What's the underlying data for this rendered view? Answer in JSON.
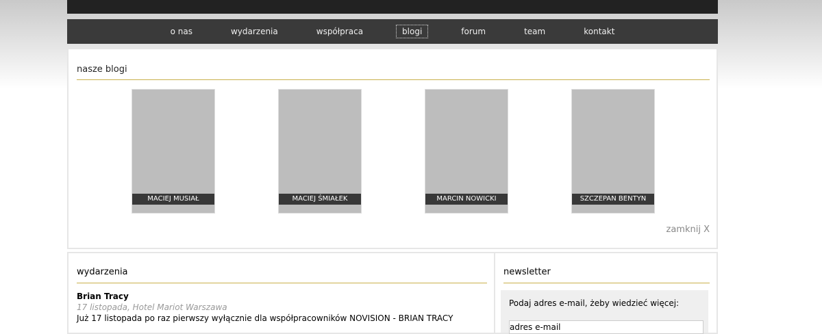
{
  "nav": [
    "o nas",
    "wydarzenia",
    "współpraca",
    "blogi",
    "forum",
    "team",
    "kontakt"
  ],
  "blogi": {
    "title": "nasze blogi",
    "authors": [
      "MACIEJ MUSIAŁ",
      "MACIEJ ŚMIAŁEK",
      "MARCIN NOWICKI",
      "SZCZEPAN BENTYN"
    ],
    "close": "zamknij X"
  },
  "wydarzenia": {
    "title": "wydarzenia",
    "headline": "Brian Tracy",
    "meta": "17 listopada, Hotel Mariot Warszawa",
    "text": "Już 17 listopada po raz pierwszy wyłącznie dla współpracowników NOVISION - BRIAN TRACY"
  },
  "newsletter": {
    "title": "newsletter",
    "prompt": "Podaj adres e-mail, żeby wiedzieć więcej:",
    "placeholder": "adres e-mail"
  }
}
